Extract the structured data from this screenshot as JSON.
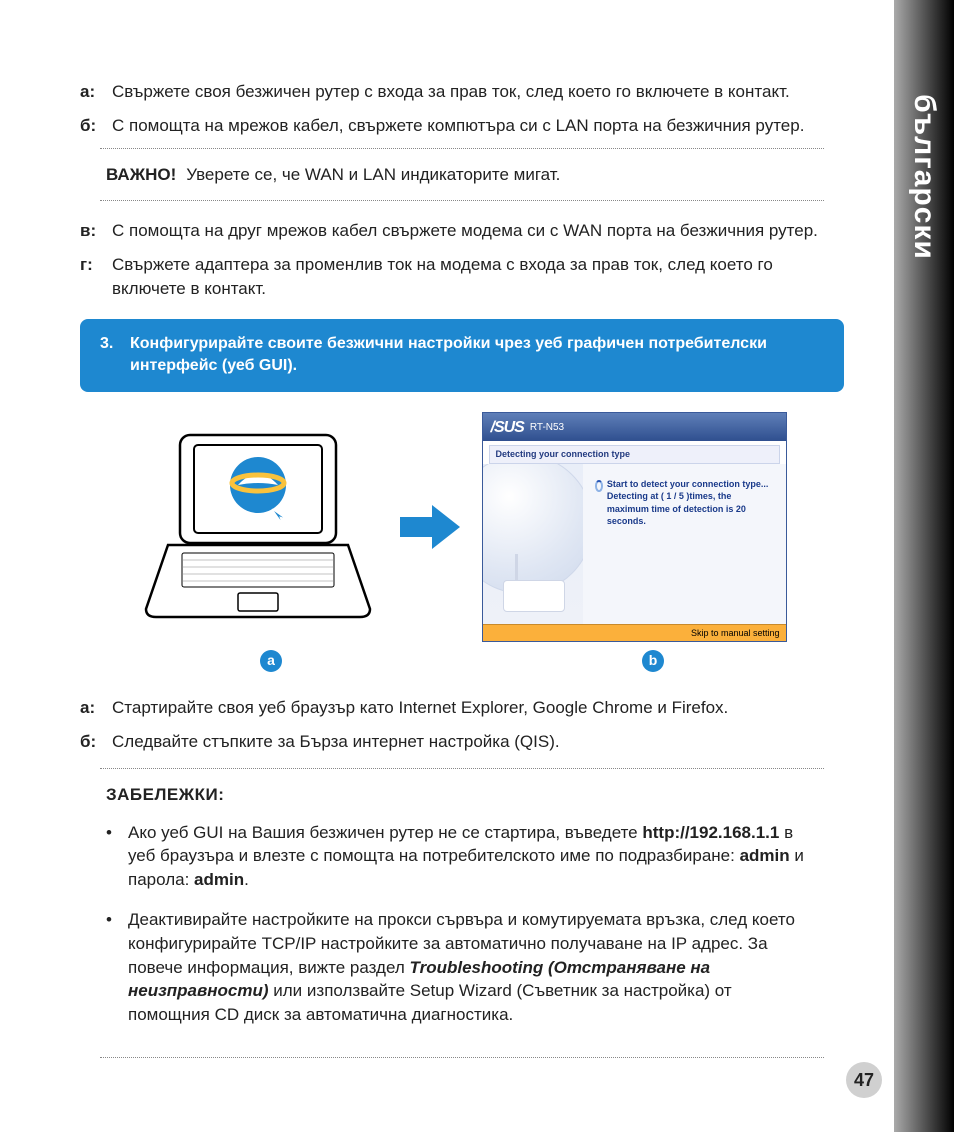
{
  "sideTab": "български",
  "steps1": {
    "a": {
      "label": "а:",
      "text": "Свържете своя безжичен рутер с входа за прав ток, след което го включете в контакт."
    },
    "b": {
      "label": "б:",
      "text": "С помощта на мрежов кабел, свържете компютъра си с LAN порта на безжичния рутер."
    }
  },
  "important": {
    "label": "ВАЖНО!",
    "text": "Уверете се, че WAN и LAN индикаторите мигат."
  },
  "steps2": {
    "v": {
      "label": "в:",
      "text": "С помощта на друг мрежов кабел свържете модема си с WAN порта на безжичния рутер."
    },
    "g": {
      "label": "г:",
      "text": "Свържете адаптера за променлив ток на модема с входа за прав ток, след което го включете в контакт."
    }
  },
  "banner": {
    "num": "3.",
    "text": "Конфигурирайте своите безжични настройки чрез уеб графичен потребителски интерфейс (уеб GUI)."
  },
  "figureLabels": {
    "a": "a",
    "b": "b"
  },
  "routerUI": {
    "logo": "/SUS",
    "model": "RT-N53",
    "subheader": "Detecting your connection type",
    "line1": "Start to detect your connection type...",
    "line2": "Detecting at ( 1 / 5 )times, the maximum time of detection is 20 seconds.",
    "footer": "Skip to manual setting"
  },
  "steps3": {
    "a": {
      "label": "а:",
      "text": "Стартирайте своя уеб браузър като Internet Explorer, Google Chrome и Firefox."
    },
    "b": {
      "label": "б:",
      "text": "Следвайте стъпките за Бърза интернет настройка (QIS)."
    }
  },
  "notes": {
    "title": "ЗАБЕЛЕЖКИ:",
    "items": [
      {
        "pre": "Ако уеб GUI на Вашия безжичен рутер не се стартира, въведете ",
        "url": "http://192.168.1.1",
        "mid": " в уеб браузъра и влезте с помощта на потребителското име по подразбиране: ",
        "user": "admin",
        "mid2": " и парола: ",
        "pass": "admin",
        "end": "."
      },
      {
        "pre": "Деактивирайте настройките на прокси сървъра и комутируемата връзка, след което конфигурирайте TCP/IP настройките за автоматично получаване на IP адрес. За повече информация, вижте раздел ",
        "bold": "Troubleshooting (Отстраняване на неизправности)",
        "end": " или използвайте Setup Wizard (Съветник за настройка) от помощния CD диск за автоматична диагностика."
      }
    ]
  },
  "pageNumber": "47"
}
